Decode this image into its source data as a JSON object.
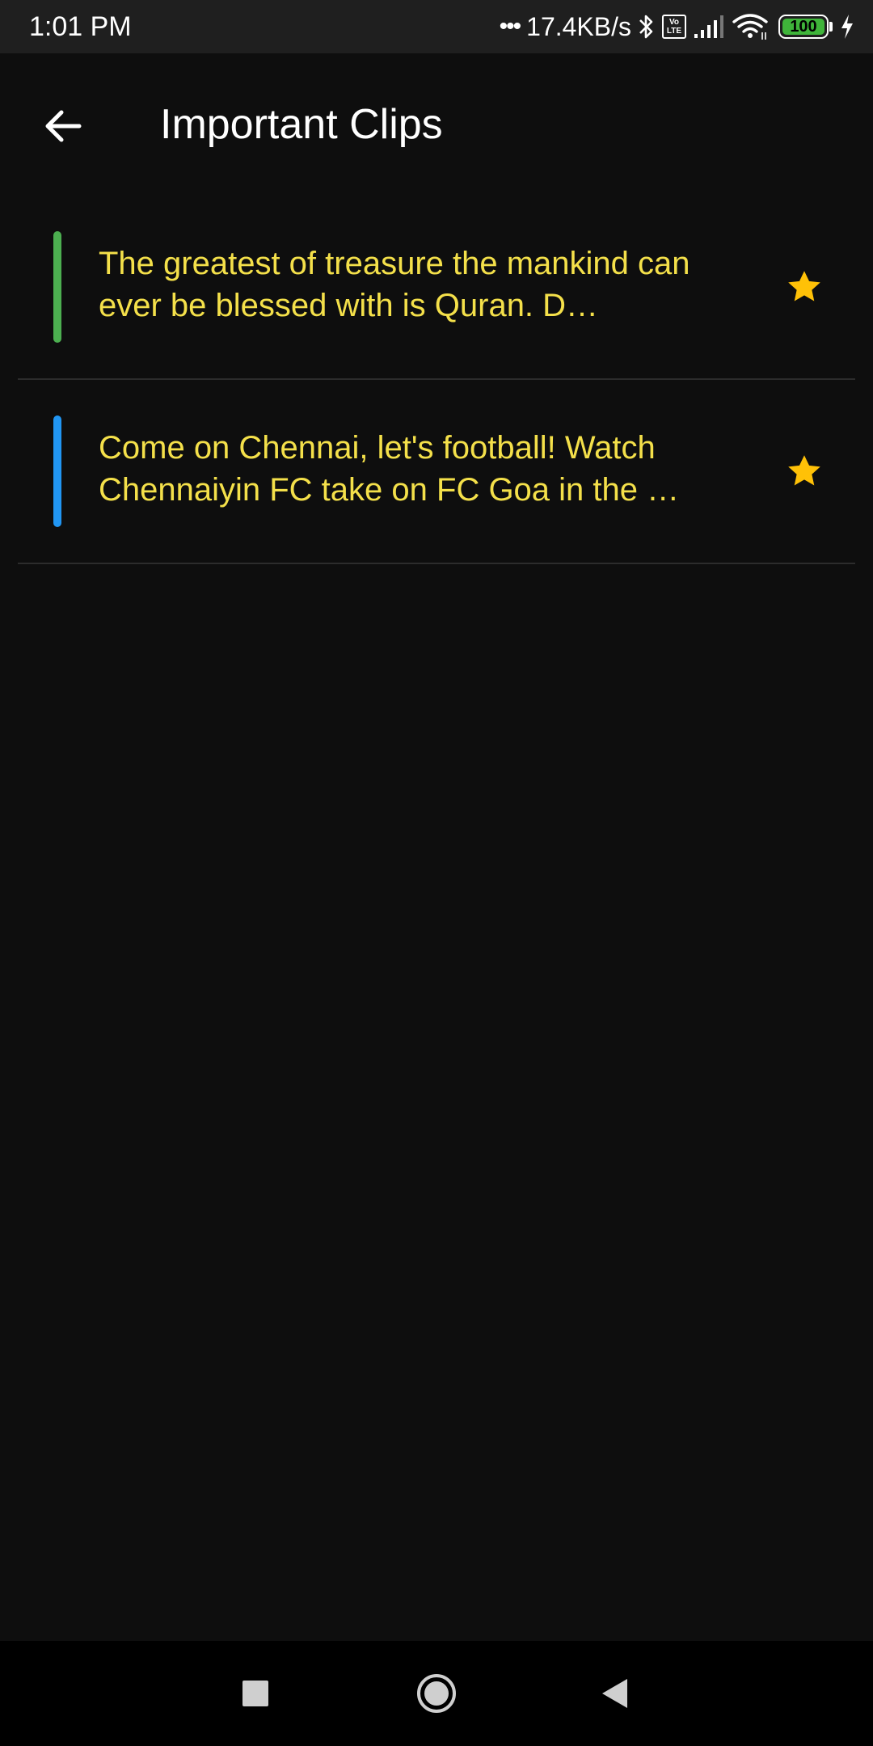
{
  "status_bar": {
    "time": "1:01 PM",
    "dots": "•••",
    "net_speed": "17.4KB/s",
    "volte_top": "Vo",
    "volte_bottom": "LTE",
    "battery": "100",
    "icons": [
      "bluetooth-icon",
      "volte-icon",
      "signal-icon",
      "wifi-icon",
      "battery-icon",
      "charging-icon"
    ]
  },
  "app_bar": {
    "title": "Important Clips",
    "back_icon": "arrow-left-icon"
  },
  "clips": [
    {
      "text": "The greatest of treasure the mankind can ever be blessed with is Quran. D…",
      "color": "#4caf50",
      "starred": true
    },
    {
      "text": "Come on Chennai, let's football! Watch Chennaiyin FC take on FC Goa in the …",
      "color": "#2196f3",
      "starred": true
    }
  ],
  "colors": {
    "background": "#0e0e0e",
    "clip_text": "#f4e04a",
    "star": "#ffc107",
    "divider": "#2c2c2c"
  },
  "nav_bar": {
    "buttons": [
      "recents-square-icon",
      "home-circle-icon",
      "back-triangle-icon"
    ]
  }
}
